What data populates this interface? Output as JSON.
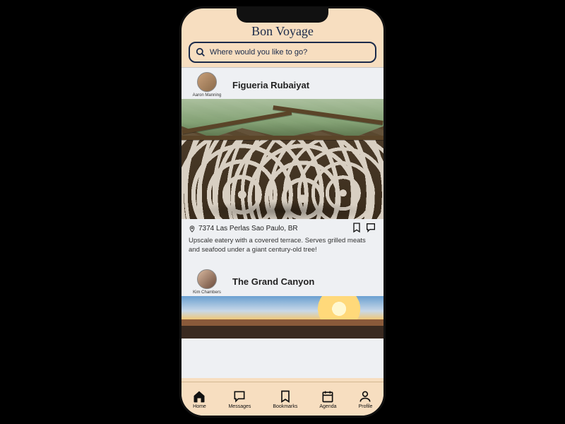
{
  "app": {
    "title": "Bon Voyage"
  },
  "search": {
    "placeholder": "Where would you like to go?"
  },
  "feed": {
    "posts": [
      {
        "author": "Aaron Manning",
        "title": "Figueria Rubaiyat",
        "address": "7374 Las Perlas Sao Paulo, BR",
        "description": "Upscale eatery with a covered terrace. Serves grilled meats and seafood under a giant century-old tree!"
      },
      {
        "author": "Kim Chambers",
        "title": "The Grand Canyon"
      }
    ]
  },
  "tabs": {
    "home": "Home",
    "messages": "Messages",
    "bookmarks": "Bookmarks",
    "agenda": "Agenda",
    "profile": "Profile"
  }
}
